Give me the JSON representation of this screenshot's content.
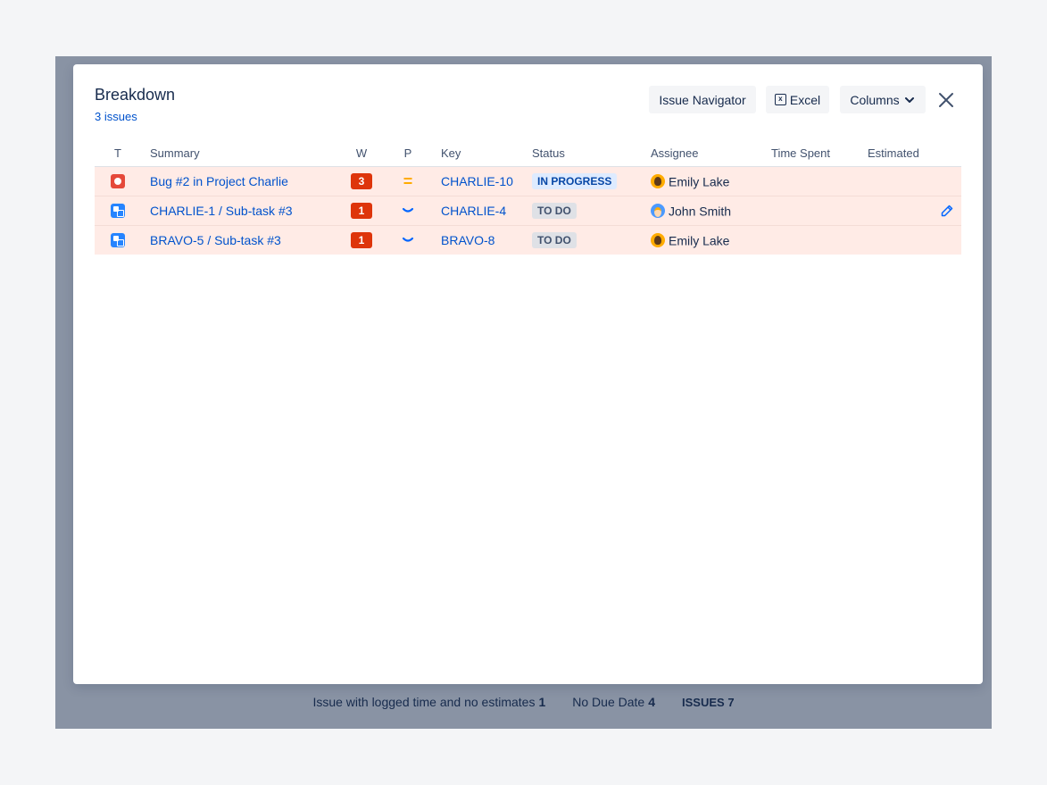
{
  "modal": {
    "title": "Breakdown",
    "subtitle": "3 issues",
    "buttons": {
      "issue_navigator": "Issue Navigator",
      "excel": "Excel",
      "excel_icon": "excel-icon",
      "columns": "Columns",
      "columns_icon": "chevron-down-icon",
      "close_icon": "close-icon"
    }
  },
  "table": {
    "headers": {
      "t": "T",
      "summary": "Summary",
      "w": "W",
      "p": "P",
      "key": "Key",
      "status": "Status",
      "assignee": "Assignee",
      "time_spent": "Time Spent",
      "estimated": "Estimated"
    },
    "rows": [
      {
        "type_icon": "bug-icon",
        "summary": "Bug #2 in Project Charlie",
        "w": "3",
        "priority": "=",
        "priority_icon": "priority-medium-icon",
        "key": "CHARLIE-10",
        "status": "IN PROGRESS",
        "assignee": "Emily Lake",
        "time_spent": "",
        "estimated": ""
      },
      {
        "type_icon": "subtask-icon",
        "summary": "CHARLIE-1 /  Sub-task #3",
        "w": "1",
        "priority": "",
        "priority_icon": "priority-low-icon",
        "key": "CHARLIE-4",
        "status": "TO DO",
        "assignee": "John Smith",
        "time_spent": "",
        "estimated": "",
        "edit_icon": "pencil-icon"
      },
      {
        "type_icon": "subtask-icon",
        "summary": "BRAVO-5 /  Sub-task #3",
        "w": "1",
        "priority": "",
        "priority_icon": "priority-low-icon",
        "key": "BRAVO-8",
        "status": "TO DO",
        "assignee": "Emily Lake",
        "time_spent": "",
        "estimated": ""
      }
    ]
  },
  "footer": {
    "logged_no_estimates_label": "Issue with logged time and no estimates",
    "logged_no_estimates_count": "1",
    "no_due_date_label": "No Due Date",
    "no_due_date_count": "4",
    "issues_label": "ISSUES",
    "issues_count": "7"
  },
  "colors": {
    "row_highlight": "#ffebe6",
    "weight_badge": "#de350b",
    "link": "#0052cc",
    "priority_medium": "#ffab00",
    "backdrop": "#8993a4"
  }
}
